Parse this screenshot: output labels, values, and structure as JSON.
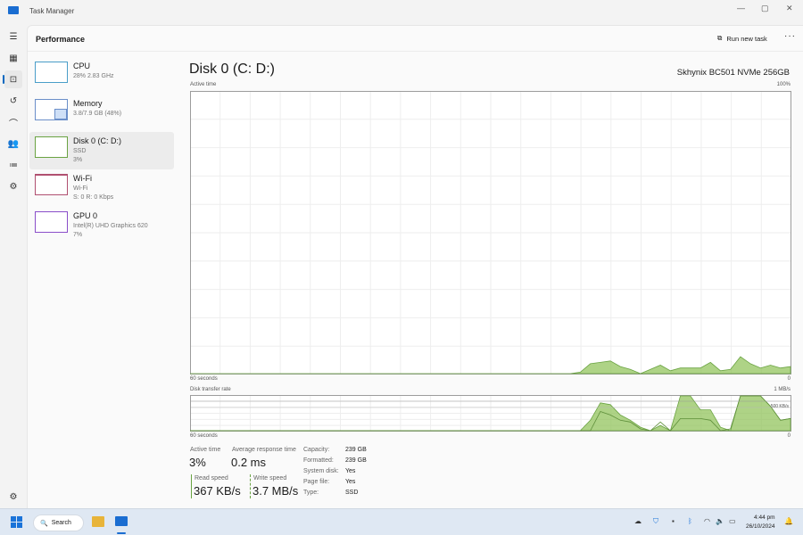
{
  "window": {
    "title": "Task Manager",
    "minimize": "—",
    "maximize": "▢",
    "close": "✕"
  },
  "header": {
    "title": "Performance",
    "run_new_task": "Run new task",
    "more": "···"
  },
  "nav": [
    "menu-icon",
    "processes-icon",
    "performance-icon",
    "app-history-icon",
    "startup-apps-icon",
    "users-icon",
    "details-icon",
    "services-icon",
    "settings-icon"
  ],
  "devices": [
    {
      "name": "CPU",
      "sub1": "28% 2.83 GHz",
      "sub2": "",
      "color": "#4a9ec9"
    },
    {
      "name": "Memory",
      "sub1": "3.8/7.9 GB (48%)",
      "sub2": "",
      "color": "#6b8fc9"
    },
    {
      "name": "Disk 0 (C: D:)",
      "sub1": "SSD",
      "sub2": "3%",
      "color": "#6aa342"
    },
    {
      "name": "Wi-Fi",
      "sub1": "Wi-Fi",
      "sub2": "S: 0 R: 0 Kbps",
      "color": "#b05070"
    },
    {
      "name": "GPU 0",
      "sub1": "Intel(R) UHD Graphics 620",
      "sub2": "7%",
      "color": "#8a4ec9"
    }
  ],
  "disk": {
    "title": "Disk 0 (C: D:)",
    "model": "Skhynix BC501 NVMe 256GB",
    "active_label": "Active time",
    "active_max": "100%",
    "seconds": "60 seconds",
    "zero": "0",
    "transfer_label": "Disk transfer rate",
    "transfer_max": "1 MB/s",
    "transfer_mid": "500 KB/s",
    "stats": {
      "active_time_label": "Active time",
      "active_time": "3%",
      "avg_resp_label": "Average response time",
      "avg_resp": "0.2 ms",
      "read_label": "Read speed",
      "read": "367 KB/s",
      "write_label": "Write speed",
      "write": "3.7 MB/s"
    },
    "props": [
      [
        "Capacity:",
        "239 GB"
      ],
      [
        "Formatted:",
        "239 GB"
      ],
      [
        "System disk:",
        "Yes"
      ],
      [
        "Page file:",
        "Yes"
      ],
      [
        "Type:",
        "SSD"
      ]
    ]
  },
  "chart_data": [
    {
      "type": "area",
      "title": "Active time",
      "xlabel": "60 seconds",
      "ylim": [
        0,
        100
      ],
      "xlim": [
        60,
        0
      ],
      "grid": true,
      "color": "#8cc152",
      "values": [
        0,
        0,
        0,
        0,
        0,
        0,
        0,
        0,
        0,
        0,
        0,
        0,
        0,
        0,
        0,
        0,
        0,
        0,
        0,
        0,
        0,
        0,
        0,
        0,
        0,
        0,
        0,
        0,
        0,
        0,
        0,
        0,
        0,
        0,
        0,
        0,
        0,
        0,
        0,
        0.5,
        3.5,
        4,
        4.5,
        2.5,
        1.5,
        0,
        1.5,
        3,
        1,
        2,
        2,
        2,
        4,
        1,
        1.5,
        6,
        3.5,
        2,
        3,
        2,
        2.5
      ]
    },
    {
      "type": "area",
      "title": "Disk transfer rate",
      "xlabel": "60 seconds",
      "ylim": [
        0,
        1000
      ],
      "unit": "KB/s",
      "grid": true,
      "series": [
        {
          "color": "#8cc152",
          "values": [
            0,
            0,
            0,
            0,
            0,
            0,
            0,
            0,
            0,
            0,
            0,
            0,
            0,
            0,
            0,
            0,
            0,
            0,
            0,
            0,
            0,
            0,
            0,
            0,
            0,
            0,
            0,
            0,
            0,
            0,
            0,
            0,
            0,
            0,
            0,
            0,
            0,
            0,
            0,
            0,
            300,
            800,
            750,
            450,
            300,
            100,
            0,
            150,
            0,
            1000,
            1000,
            600,
            600,
            100,
            0,
            1000,
            1000,
            1000,
            700,
            300,
            350
          ]
        },
        {
          "color": "#5e8f3a",
          "values": [
            0,
            0,
            0,
            0,
            0,
            0,
            0,
            0,
            0,
            0,
            0,
            0,
            0,
            0,
            0,
            0,
            0,
            0,
            0,
            0,
            0,
            0,
            0,
            0,
            0,
            0,
            0,
            0,
            0,
            0,
            0,
            0,
            0,
            0,
            0,
            0,
            0,
            0,
            0,
            0,
            0,
            550,
            450,
            300,
            250,
            50,
            0,
            250,
            0,
            350,
            350,
            350,
            300,
            0,
            50,
            1000,
            1000,
            1000,
            700,
            300,
            350
          ]
        }
      ]
    }
  ],
  "taskbar": {
    "search": "Search",
    "time": "4:44 pm",
    "date": "26/10/2024"
  }
}
